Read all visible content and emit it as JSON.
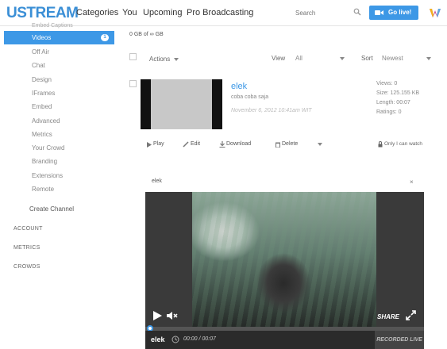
{
  "header": {
    "logo": "USTREAM",
    "nav": [
      "Categories",
      "You",
      "Upcoming",
      "Pro Broadcasting"
    ],
    "search_placeholder": "Search",
    "go_live_label": "Go live!",
    "accent_color": "#3d98e6"
  },
  "sidebar": {
    "top_partial": "Embed Captions",
    "items": [
      {
        "label": "Videos",
        "badge": "1",
        "active": true
      },
      {
        "label": "Off Air"
      },
      {
        "label": "Chat"
      },
      {
        "label": "Design"
      },
      {
        "label": "IFrames"
      },
      {
        "label": "Embed"
      },
      {
        "label": "Advanced"
      },
      {
        "label": "Metrics"
      },
      {
        "label": "Your Crowd"
      },
      {
        "label": "Branding"
      },
      {
        "label": "Extensions"
      },
      {
        "label": "Remote"
      }
    ],
    "create_channel": "Create Channel",
    "sections": [
      "ACCOUNT",
      "METRICS",
      "CROWDS"
    ]
  },
  "main": {
    "storage": "0 GB of ∞ GB",
    "actions_label": "Actions",
    "view_label": "View",
    "view_value": "All",
    "sort_label": "Sort",
    "sort_value": "Newest",
    "video": {
      "title": "elek",
      "description": "coba coba saja",
      "date": "November 6, 2012 10:41am WIT",
      "views": "Views: 0",
      "size": "Size: 125.155 KB",
      "length": "Length: 00:07",
      "ratings": "Ratings: 0"
    },
    "item_actions": [
      "Play",
      "Edit",
      "Download",
      "Delete"
    ],
    "privacy": "Only I can watch"
  },
  "player": {
    "title": "elek",
    "close": "×",
    "share": "SHARE",
    "bottom_title": "elek",
    "time": "00:00 / 00:07",
    "recorded": "RECORDED LIVE",
    "progress": 0.0
  }
}
